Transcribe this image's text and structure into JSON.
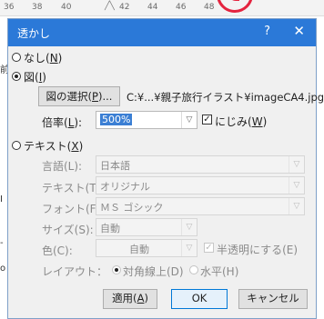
{
  "ruler": {
    "ticks": [
      "36",
      "38",
      "40",
      "42",
      "44",
      "46",
      "48"
    ]
  },
  "background_chars": {
    "left1": "前",
    "left2": "I",
    "left3": "-",
    "left4": "o"
  },
  "dialog": {
    "title": "透かし",
    "help": "?",
    "close": "✕",
    "none_option": {
      "label": "なし(",
      "key": "N",
      "tail": ")",
      "checked": false
    },
    "picture_option": {
      "label": "図(",
      "key": "I",
      "tail": ")",
      "checked": true
    },
    "select_picture_button": {
      "label": "図の選択(",
      "key": "P",
      "tail": ")..."
    },
    "picture_path": "C:¥...¥親子旅行イラスト¥imageCA4.jpg",
    "scale": {
      "label": "倍率(",
      "key": "L",
      "tail": "):",
      "value": "500%"
    },
    "washout": {
      "label": "にじみ(",
      "key": "W",
      "tail": ")",
      "checked": true
    },
    "text_option": {
      "label": "テキスト(",
      "key": "X",
      "tail": ")",
      "checked": false
    },
    "language": {
      "label": "言語(L):",
      "value": "日本語"
    },
    "text": {
      "label": "テキスト(T):",
      "value": "オリジナル"
    },
    "font": {
      "label": "フォント(F):",
      "value": "ＭＳ ゴシック"
    },
    "size": {
      "label": "サイズ(S):",
      "value": "自動"
    },
    "color": {
      "label": "色(C):",
      "value": "自動"
    },
    "semitransparent": {
      "label": "半透明にする(E)",
      "checked": true
    },
    "layout": {
      "label": "レイアウト：",
      "diagonal": "対角線上(D)",
      "horizontal": "水平(H)"
    },
    "apply_button": {
      "label": "適用(",
      "key": "A",
      "tail": ")"
    },
    "ok_button": {
      "label": "OK"
    },
    "cancel_button": {
      "label": "キャンセル"
    }
  },
  "colors": {
    "titlebar": "#2b79d8",
    "highlight": "#3b7fd4",
    "annotation_circle": "#e4243f"
  }
}
